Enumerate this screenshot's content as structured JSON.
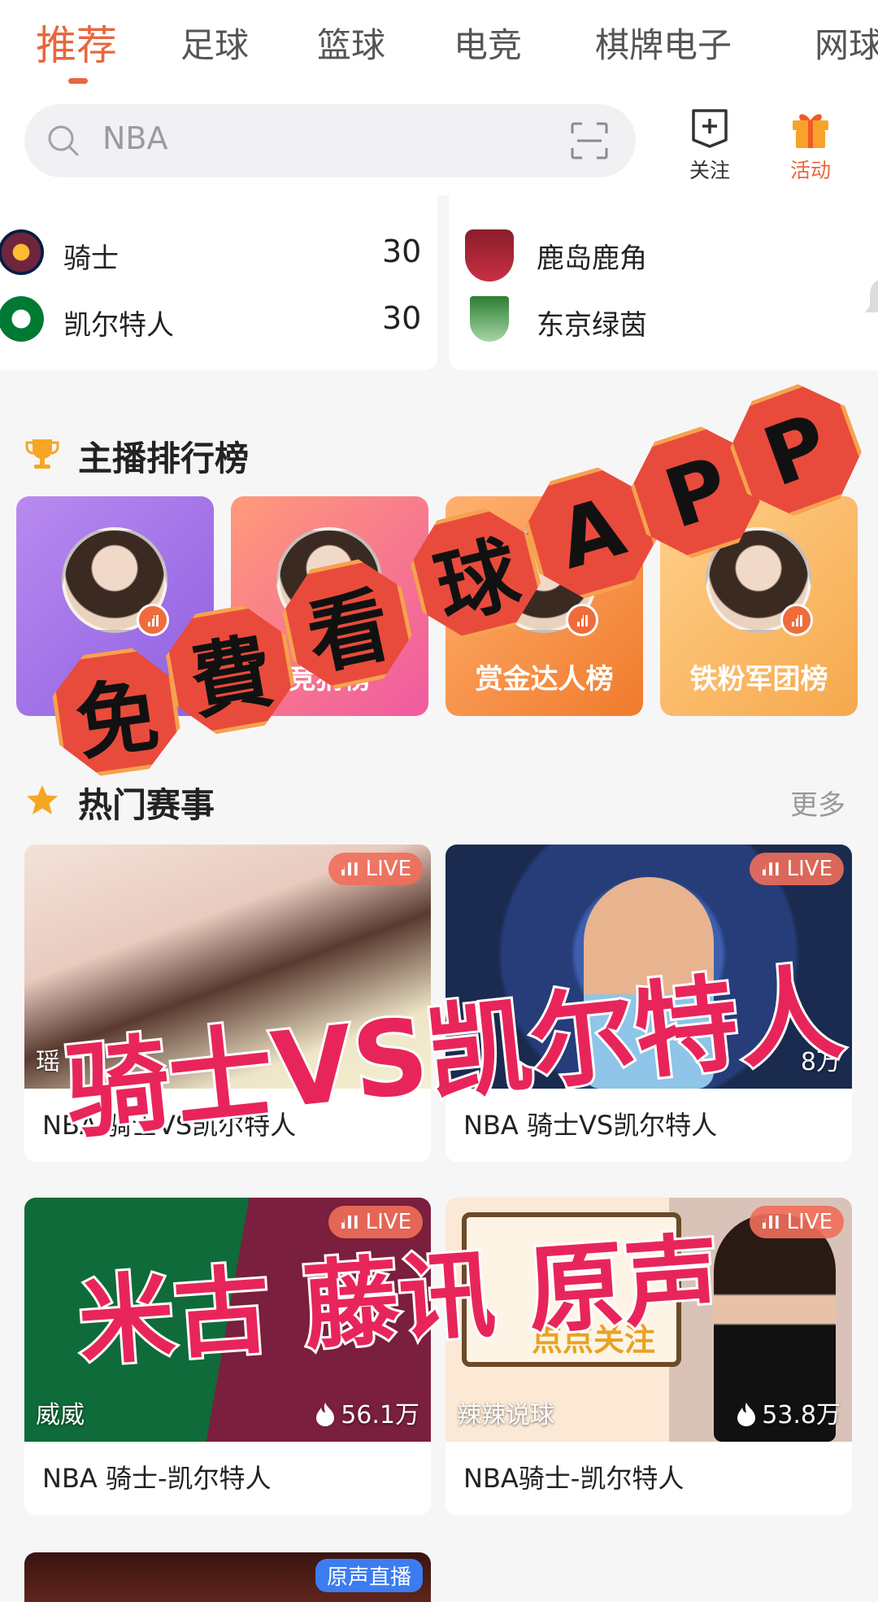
{
  "tabs": [
    "推荐",
    "足球",
    "篮球",
    "电竞",
    "棋牌电子",
    "网球"
  ],
  "search": {
    "placeholder": "NBA"
  },
  "actions": {
    "follow": "关注",
    "activity": "活动"
  },
  "scores": {
    "left": {
      "home": {
        "name": "骑士",
        "score": "30"
      },
      "away": {
        "name": "凯尔特人",
        "score": "30"
      }
    },
    "right": {
      "home": {
        "name": "鹿岛鹿角"
      },
      "away": {
        "name": "东京绿茵"
      }
    }
  },
  "ranking": {
    "title": "主播排行榜",
    "cards": [
      {
        "label": "人气榜"
      },
      {
        "label": "竞猜榜"
      },
      {
        "label": "赏金达人榜"
      },
      {
        "label": "铁粉军团榜"
      }
    ]
  },
  "hot": {
    "title": "热门赛事",
    "more": "更多",
    "matches": [
      {
        "live": "LIVE",
        "streamer": "瑶",
        "viewers": "",
        "title": "NBA 骑士VS凯尔特人"
      },
      {
        "live": "LIVE",
        "streamer": "",
        "viewers": "8万",
        "title": "NBA 骑士VS凯尔特人"
      },
      {
        "live": "LIVE",
        "streamer": "威威",
        "viewers": "56.1万",
        "title": "NBA 骑士-凯尔特人"
      },
      {
        "live": "LIVE",
        "streamer": "辣辣说球",
        "viewers": "53.8万",
        "title": "NBA骑士-凯尔特人"
      }
    ],
    "next_badge": "原声直播"
  },
  "thumb_texts": {
    "card4_banner": "点点关注"
  },
  "promo": {
    "hex_chars": [
      "免",
      "費",
      "看",
      "球",
      "A",
      "P",
      "P"
    ],
    "line1": "骑士VS凯尔特人",
    "line2": "米古 藤讯 原声"
  },
  "colors": {
    "accent": "#e8673e",
    "promo_red": "#e8255a",
    "hex_red": "#e84b3c"
  }
}
